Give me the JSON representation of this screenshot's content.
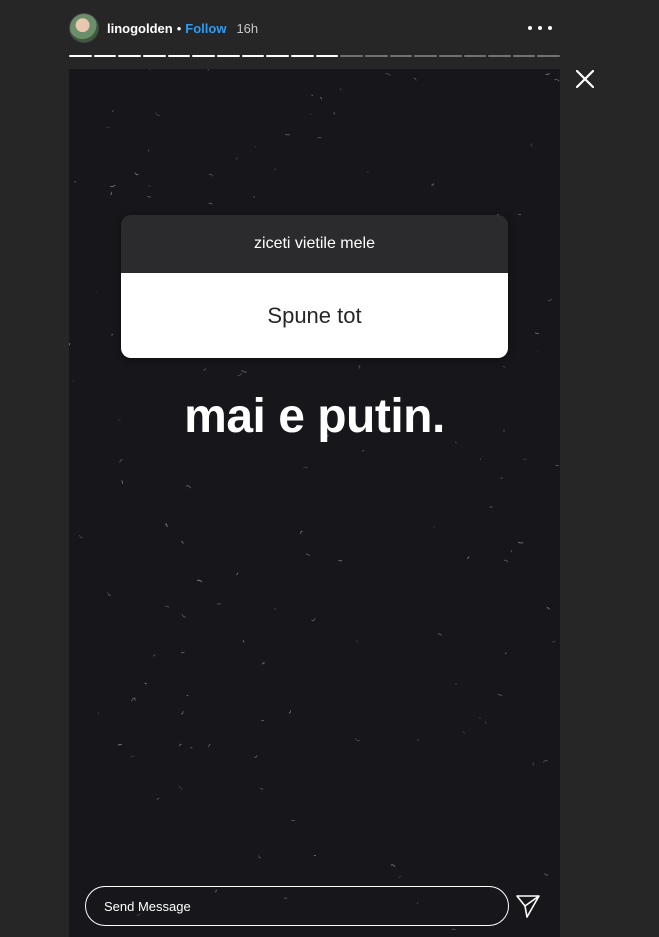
{
  "header": {
    "username": "linogolden",
    "separator": "•",
    "follow_label": "Follow",
    "time": "16h"
  },
  "progress": {
    "total_segments": 20,
    "completed_segments": 11
  },
  "story": {
    "question_prompt": "ziceti vietile mele",
    "question_answer": "Spune tot",
    "caption": "mai e putin."
  },
  "reply": {
    "placeholder": "Send Message"
  },
  "icons": {
    "close": "close-icon",
    "more": "more-options-icon",
    "send": "send-icon"
  },
  "colors": {
    "background": "#262626",
    "story_background": "#17161a",
    "follow": "#2f9bf0"
  }
}
